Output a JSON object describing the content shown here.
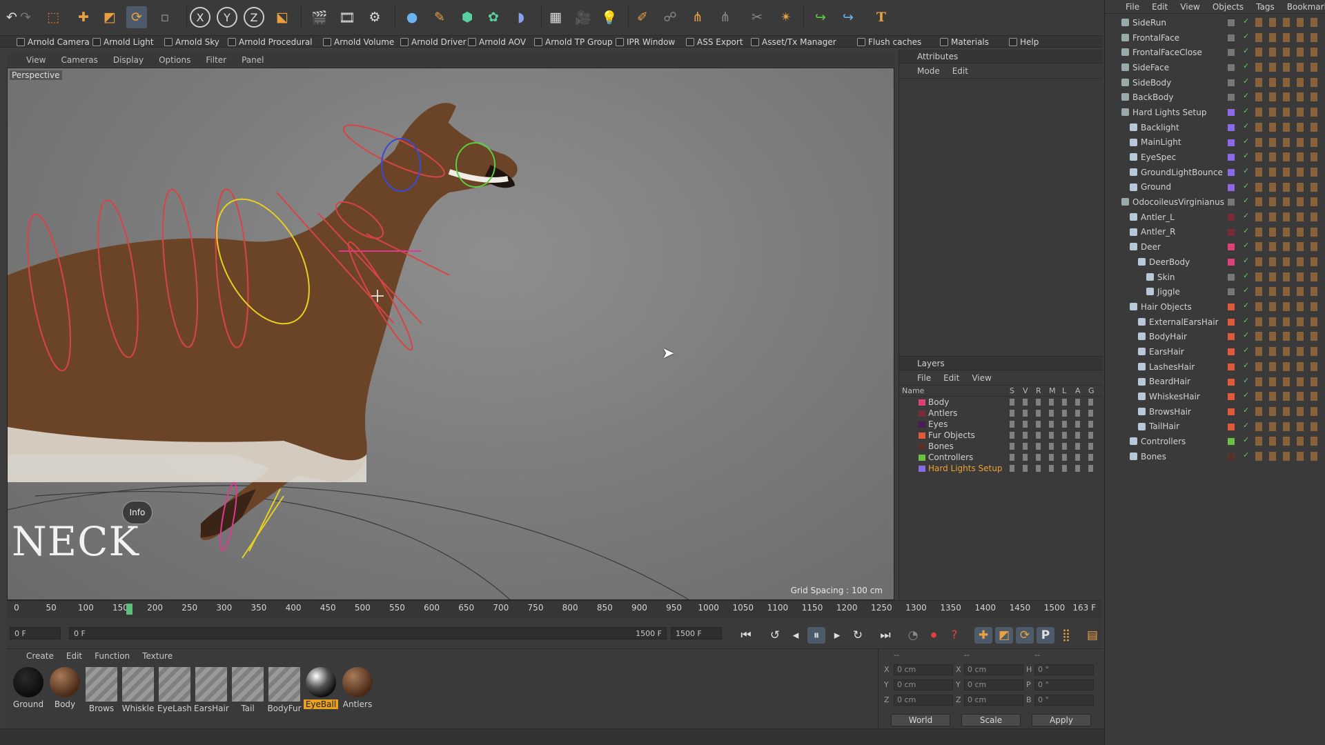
{
  "plugin_bar": [
    {
      "label": "Arnold Camera"
    },
    {
      "label": "Arnold Light"
    },
    {
      "label": "Arnold Sky"
    },
    {
      "label": "Arnold Procedural"
    },
    {
      "label": "Arnold Volume"
    },
    {
      "label": "Arnold Driver"
    },
    {
      "label": "Arnold AOV"
    },
    {
      "label": "Arnold TP Group"
    },
    {
      "label": "IPR Window"
    },
    {
      "label": "ASS Export"
    },
    {
      "label": "Asset/Tx Manager"
    },
    {
      "label": "Flush caches"
    },
    {
      "label": "Materials"
    },
    {
      "label": "Help"
    }
  ],
  "toolbar": {
    "axis_x": "X",
    "axis_y": "Y",
    "axis_z": "Z",
    "text_tool": "T"
  },
  "viewport": {
    "menu": [
      "View",
      "Cameras",
      "Display",
      "Options",
      "Filter",
      "Panel"
    ],
    "camera_label": "Perspective",
    "grid_spacing": "Grid Spacing : 100 cm",
    "overlay_title": "NECK",
    "info_bubble": "Info"
  },
  "attributes": {
    "title": "Attributes",
    "menu": [
      "Mode",
      "Edit"
    ]
  },
  "layers": {
    "title": "Layers",
    "menu": [
      "File",
      "Edit",
      "View"
    ],
    "header": {
      "name": "Name",
      "s": "S",
      "v": "V",
      "r": "R",
      "m": "M",
      "l": "L",
      "a": "A",
      "g": "G"
    },
    "rows": [
      {
        "name": "Body",
        "color": "#e0407a",
        "highlight": false
      },
      {
        "name": "Antlers",
        "color": "#7a2a38",
        "highlight": false
      },
      {
        "name": "Eyes",
        "color": "#4a1a5a",
        "highlight": false
      },
      {
        "name": "Fur Objects",
        "color": "#e05a3a",
        "highlight": false
      },
      {
        "name": "Bones",
        "color": "#5a3028",
        "highlight": false
      },
      {
        "name": "Controllers",
        "color": "#6ac040",
        "highlight": false
      },
      {
        "name": "Hard Lights Setup",
        "color": "#8a6ae8",
        "highlight": true
      }
    ]
  },
  "object_manager": {
    "menu": [
      "File",
      "Edit",
      "View",
      "Objects",
      "Tags",
      "Bookmarks"
    ],
    "rows": [
      {
        "name": "SideRun",
        "indent": 0,
        "color": "#777777"
      },
      {
        "name": "FrontalFace",
        "indent": 0,
        "color": "#777777"
      },
      {
        "name": "FrontalFaceClose",
        "indent": 0,
        "color": "#777777"
      },
      {
        "name": "SideFace",
        "indent": 0,
        "color": "#777777"
      },
      {
        "name": "SideBody",
        "indent": 0,
        "color": "#777777"
      },
      {
        "name": "BackBody",
        "indent": 0,
        "color": "#777777"
      },
      {
        "name": "Hard Lights Setup",
        "indent": 0,
        "color": "#8a6ae8"
      },
      {
        "name": "Backlight",
        "indent": 1,
        "color": "#8a6ae8"
      },
      {
        "name": "MainLight",
        "indent": 1,
        "color": "#8a6ae8"
      },
      {
        "name": "EyeSpec",
        "indent": 1,
        "color": "#8a6ae8"
      },
      {
        "name": "GroundLightBounce",
        "indent": 1,
        "color": "#8a6ae8"
      },
      {
        "name": "Ground",
        "indent": 1,
        "color": "#8a6ae8"
      },
      {
        "name": "OdocoileusVirginianus",
        "indent": 0,
        "color": "#777777"
      },
      {
        "name": "Antler_L",
        "indent": 1,
        "color": "#7a2a38"
      },
      {
        "name": "Antler_R",
        "indent": 1,
        "color": "#7a2a38"
      },
      {
        "name": "Deer",
        "indent": 1,
        "color": "#e0407a"
      },
      {
        "name": "DeerBody",
        "indent": 2,
        "color": "#e0407a"
      },
      {
        "name": "Skin",
        "indent": 3,
        "color": "#777777"
      },
      {
        "name": "Jiggle",
        "indent": 3,
        "color": "#777777"
      },
      {
        "name": "Hair Objects",
        "indent": 1,
        "color": "#e05a3a"
      },
      {
        "name": "ExternalEarsHair",
        "indent": 2,
        "color": "#e05a3a"
      },
      {
        "name": "BodyHair",
        "indent": 2,
        "color": "#e05a3a"
      },
      {
        "name": "EarsHair",
        "indent": 2,
        "color": "#e05a3a"
      },
      {
        "name": "LashesHair",
        "indent": 2,
        "color": "#e05a3a"
      },
      {
        "name": "BeardHair",
        "indent": 2,
        "color": "#e05a3a"
      },
      {
        "name": "WhiskesHair",
        "indent": 2,
        "color": "#e05a3a"
      },
      {
        "name": "BrowsHair",
        "indent": 2,
        "color": "#e05a3a"
      },
      {
        "name": "TailHair",
        "indent": 2,
        "color": "#e05a3a"
      },
      {
        "name": "Controllers",
        "indent": 1,
        "color": "#6ac040"
      },
      {
        "name": "Bones",
        "indent": 1,
        "color": "#5a3028"
      }
    ]
  },
  "timeline": {
    "ticks": [
      "0",
      "50",
      "100",
      "150",
      "200",
      "250",
      "300",
      "350",
      "400",
      "450",
      "500",
      "550",
      "600",
      "650",
      "700",
      "750",
      "800",
      "850",
      "900",
      "950",
      "1000",
      "1050",
      "1100",
      "1150",
      "1200",
      "1250",
      "1300",
      "1350",
      "1400",
      "1450",
      "1500"
    ],
    "current_frame": "163 F",
    "current_frame_value": 163,
    "max_frame": 1500
  },
  "transport": {
    "start_field": "0 F",
    "range_start": "0 F",
    "range_end": "1500 F",
    "end_field": "1500 F"
  },
  "materials": {
    "menu": [
      "Create",
      "Edit",
      "Function",
      "Texture"
    ],
    "items": [
      {
        "name": "Ground",
        "style": "black",
        "active": false
      },
      {
        "name": "Body",
        "style": "brown",
        "active": false
      },
      {
        "name": "Brows",
        "style": "stripe",
        "active": false
      },
      {
        "name": "Whiskle",
        "style": "stripe",
        "active": false
      },
      {
        "name": "EyeLash",
        "style": "stripe",
        "active": false
      },
      {
        "name": "EarsHair",
        "style": "stripe",
        "active": false
      },
      {
        "name": "Tail",
        "style": "stripe",
        "active": false
      },
      {
        "name": "BodyFur",
        "style": "stripe",
        "active": false
      },
      {
        "name": "EyeBall",
        "style": "eyeball",
        "active": true
      },
      {
        "name": "Antlers",
        "style": "brown",
        "active": false
      }
    ]
  },
  "coordinates": {
    "header": [
      "--",
      "--",
      "--"
    ],
    "rows": [
      {
        "a": "X",
        "av": "0 cm",
        "b": "X",
        "bv": "0 cm",
        "c": "H",
        "cv": "0 °"
      },
      {
        "a": "Y",
        "av": "0 cm",
        "b": "Y",
        "bv": "0 cm",
        "c": "P",
        "cv": "0 °"
      },
      {
        "a": "Z",
        "av": "0 cm",
        "b": "Z",
        "bv": "0 cm",
        "c": "B",
        "cv": "0 °"
      }
    ],
    "mode": "World",
    "scale": "Scale",
    "apply": "Apply"
  }
}
